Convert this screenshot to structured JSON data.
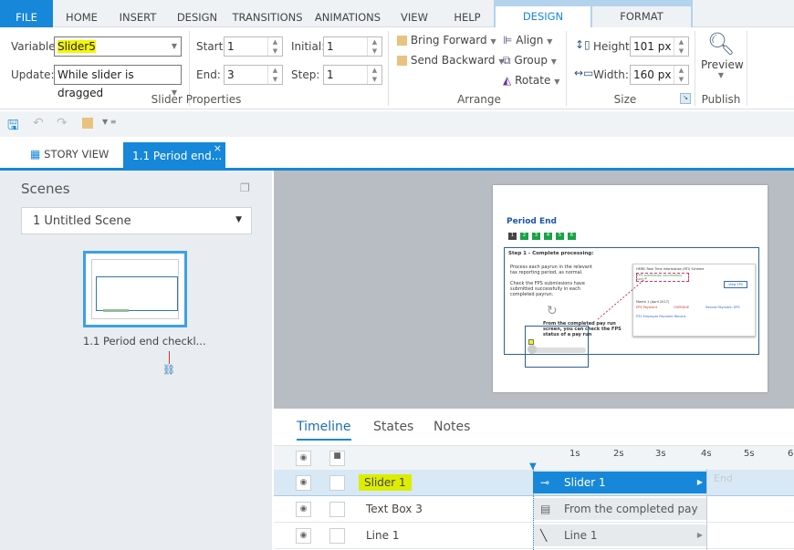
{
  "ribbon": {
    "tabs": [
      "FILE",
      "HOME",
      "INSERT",
      "DESIGN",
      "TRANSITIONS",
      "ANIMATIONS",
      "VIEW",
      "HELP"
    ],
    "context_tabs": [
      "DESIGN",
      "FORMAT"
    ],
    "slider_props": {
      "variable_label": "Variable:",
      "variable_value": "Slider5",
      "update_label": "Update:",
      "update_value": "While slider is dragged",
      "start_label": "Start:",
      "start_value": "1",
      "end_label": "End:",
      "end_value": "3",
      "initial_label": "Initial:",
      "initial_value": "1",
      "step_label": "Step:",
      "step_value": "1",
      "group_label": "Slider Properties"
    },
    "arrange": {
      "bring_forward": "Bring Forward",
      "send_backward": "Send Backward",
      "align": "Align",
      "group": "Group",
      "rotate": "Rotate",
      "group_label": "Arrange"
    },
    "size": {
      "height_label": "Height:",
      "height_value": "101 px",
      "width_label": "Width:",
      "width_value": "160 px",
      "group_label": "Size"
    },
    "publish": {
      "preview": "Preview",
      "group_label": "Publish"
    }
  },
  "doc_tabs": {
    "story_view": "STORY VIEW",
    "active": "1.1 Period end...",
    "close": "×"
  },
  "scenes": {
    "title": "Scenes",
    "dropdown": "1 Untitled Scene",
    "slide_label": "1.1 Period end checkl..."
  },
  "slide": {
    "title": "Period End",
    "steps": [
      "1",
      "2",
      "3",
      "4",
      "5",
      "6"
    ],
    "heading": "Step 1 - Complete processing:",
    "bullets": [
      "Process each payrun in the relevant tax reporting period, as normal.",
      "Check the FPS submissions have submitted successfully in each completed payrun."
    ],
    "callout": "From the completed pay run screen, you can check the FPS status of a pay run",
    "shot": {
      "title": "HMRC Real Time Information (RTI) Scheme",
      "status": "FPS submission successfully sent",
      "button": "View FPS",
      "month": "Month 1 (April 2017)",
      "eps": "EPS Payment",
      "overdue": "OVERDUE",
      "record": "Record Payment: EPS",
      "p32": "P32 Employer Payment Record"
    }
  },
  "timeline": {
    "tabs": [
      "Timeline",
      "States",
      "Notes"
    ],
    "ticks": [
      "1s",
      "2s",
      "3s",
      "4s",
      "5s",
      "6"
    ],
    "end_label": "End",
    "rows": [
      {
        "name": "Slider 1",
        "bar": "Slider 1"
      },
      {
        "name": "Text Box 3",
        "bar": "From the completed pay ..."
      },
      {
        "name": "Line 1",
        "bar": "Line 1"
      }
    ]
  },
  "colors": {
    "accent": "#1687d9",
    "highlight": "#f4f500"
  }
}
